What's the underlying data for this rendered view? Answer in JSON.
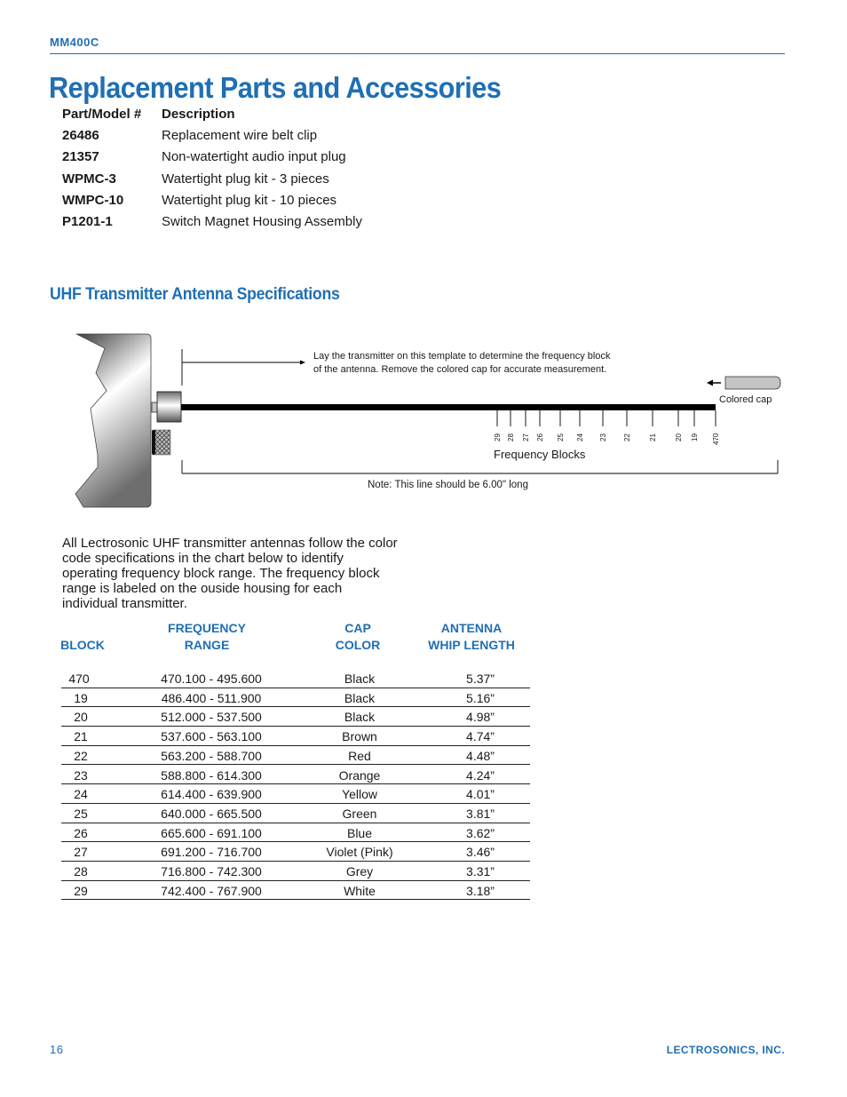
{
  "header": {
    "model": "MM400C"
  },
  "page_title": "Replacement Parts and Accessories",
  "parts_table": {
    "headers": [
      "Part/Model #",
      "Description"
    ],
    "rows": [
      {
        "part": "26486",
        "description": "Replacement wire belt clip"
      },
      {
        "part": "21357",
        "description": "Non-watertight audio input plug"
      },
      {
        "part": "WPMC-3",
        "description": "Watertight plug kit - 3 pieces"
      },
      {
        "part": "WMPC-10",
        "description": "Watertight plug kit - 10 pieces"
      },
      {
        "part": "P1201-1",
        "description": "Switch Magnet Housing Assembly"
      }
    ]
  },
  "section_title": "UHF Transmitter Antenna Specifications",
  "diagram": {
    "instruction_line1": "Lay the transmitter on this template to determine the frequency block",
    "instruction_line2": "of the antenna. Remove the colored cap for accurate measurement.",
    "cap_label": "Colored cap",
    "blocks_label": "Frequency Blocks",
    "note": "Note:  This line should be 6.00\" long",
    "tick_labels": [
      "29",
      "28",
      "27",
      "26",
      "25",
      "24",
      "23",
      "22",
      "21",
      "20",
      "19",
      "470"
    ]
  },
  "intro_text": "All Lectrosonic UHF transmitter antennas follow the color code specifications in the chart below to identify operating frequency block range. The frequency block range is labeled on the ouside housing for each individual transmitter.",
  "spec_table": {
    "headers": {
      "block": "BLOCK",
      "freq_line1": "FREQUENCY",
      "freq_line2": "RANGE",
      "cap_line1": "CAP",
      "cap_line2": "COLOR",
      "ant_line1": "ANTENNA",
      "ant_line2": "WHIP LENGTH"
    },
    "rows": [
      {
        "block": "470",
        "range": "470.100 - 495.600",
        "cap": "Black",
        "length": "5.37”"
      },
      {
        "block": "19",
        "range": "486.400 - 511.900",
        "cap": "Black",
        "length": "5.16”"
      },
      {
        "block": "20",
        "range": "512.000 - 537.500",
        "cap": "Black",
        "length": "4.98”"
      },
      {
        "block": "21",
        "range": "537.600 - 563.100",
        "cap": "Brown",
        "length": "4.74”"
      },
      {
        "block": "22",
        "range": "563.200 - 588.700",
        "cap": "Red",
        "length": "4.48”"
      },
      {
        "block": "23",
        "range": "588.800 - 614.300",
        "cap": "Orange",
        "length": "4.24”"
      },
      {
        "block": "24",
        "range": "614.400 - 639.900",
        "cap": "Yellow",
        "length": "4.01”"
      },
      {
        "block": "25",
        "range": "640.000 - 665.500",
        "cap": "Green",
        "length": "3.81”"
      },
      {
        "block": "26",
        "range": "665.600 - 691.100",
        "cap": "Blue",
        "length": "3.62”"
      },
      {
        "block": "27",
        "range": "691.200 - 716.700",
        "cap": "Violet (Pink)",
        "length": "3.46”"
      },
      {
        "block": "28",
        "range": "716.800 - 742.300",
        "cap": "Grey",
        "length": "3.31”"
      },
      {
        "block": "29",
        "range": "742.400 - 767.900",
        "cap": "White",
        "length": "3.18”"
      }
    ]
  },
  "footer": {
    "page_number": "16",
    "company": "LECTROSONICS, INC."
  },
  "colors": {
    "brand_blue": "#1f6fb4",
    "text": "#1a1a1a"
  }
}
